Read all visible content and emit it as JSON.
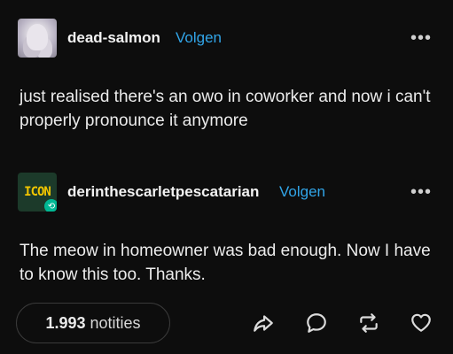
{
  "post": {
    "author": "dead-salmon",
    "follow_label": "Volgen",
    "more_label": "•••",
    "text": "just realised there's an owo in coworker and now i can't properly pronounce it anymore"
  },
  "reblog": {
    "avatar_text": "ICON",
    "author": "derinthescarletpescatarian",
    "follow_label": "Volgen",
    "more_label": "•••",
    "text": "The meow in homeowner was bad enough. Now I have to know this too. Thanks."
  },
  "footer": {
    "notes_count": "1.993",
    "notes_label": "notities"
  },
  "icons": {
    "share": "share-icon",
    "reply": "reply-icon",
    "reblog": "reblog-icon",
    "like": "heart-icon",
    "more": "more-icon"
  }
}
